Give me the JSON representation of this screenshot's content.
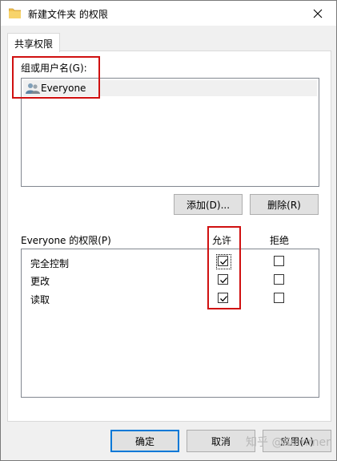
{
  "window": {
    "title": "新建文件夹 的权限",
    "close_icon": "close-icon"
  },
  "tabs": [
    {
      "label": "共享权限"
    }
  ],
  "share": {
    "group_label": "组或用户名(G):",
    "users": [
      {
        "name": "Everyone",
        "icon": "users-icon"
      }
    ],
    "add_label": "添加(D)...",
    "remove_label": "删除(R)"
  },
  "permissions": {
    "title": "Everyone 的权限(P)",
    "allow_header": "允许",
    "deny_header": "拒绝",
    "rows": [
      {
        "name": "完全控制",
        "allow": true,
        "deny": false
      },
      {
        "name": "更改",
        "allow": true,
        "deny": false
      },
      {
        "name": "读取",
        "allow": true,
        "deny": false
      }
    ]
  },
  "footer": {
    "ok_label": "确定",
    "cancel_label": "取消",
    "apply_label": "应用(A)"
  },
  "watermark": "知乎 @Summer",
  "colors": {
    "highlight": "#d01010",
    "focus": "#0078d7"
  }
}
